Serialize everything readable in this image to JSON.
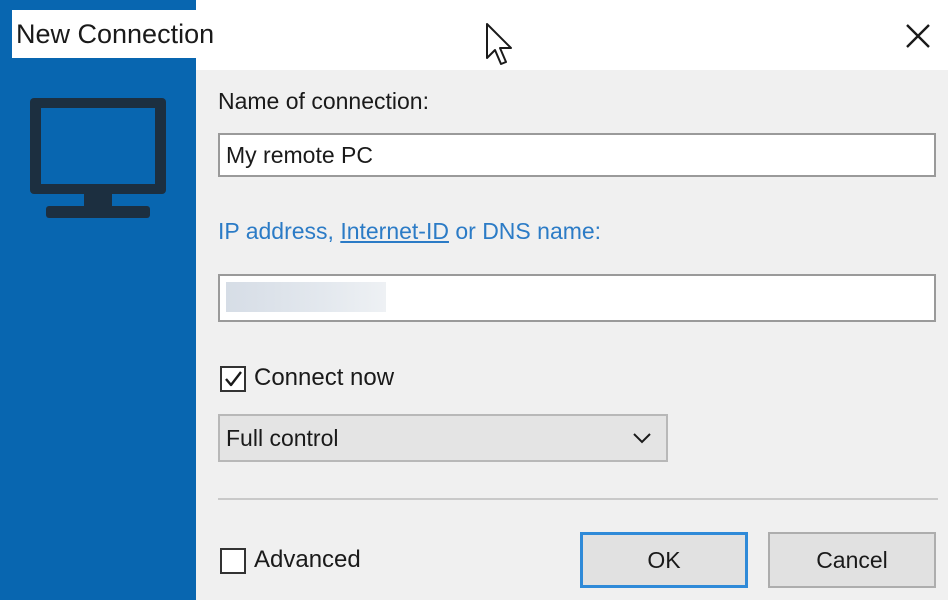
{
  "window": {
    "title": "New Connection"
  },
  "form": {
    "name_label": "Name of connection:",
    "name_value": "My remote PC",
    "ip_label_prefix": "IP address, ",
    "ip_label_link": "Internet-ID",
    "ip_label_suffix": " or DNS name:",
    "ip_value": "",
    "connect_now_label": "Connect now",
    "connect_now_checked": true,
    "mode_selected": "Full control",
    "advanced_label": "Advanced",
    "advanced_checked": false
  },
  "buttons": {
    "ok_label": "OK",
    "cancel_label": "Cancel"
  },
  "icons": {
    "sidebar": "monitor-icon",
    "close": "close-icon",
    "dropdown": "chevron-down-icon",
    "check": "check-mark-icon",
    "cursor": "mouse-cursor-icon"
  },
  "colors": {
    "sidebar": "#0866b0",
    "link": "#2b7bc6",
    "default_button_border": "#2f8ad8"
  }
}
